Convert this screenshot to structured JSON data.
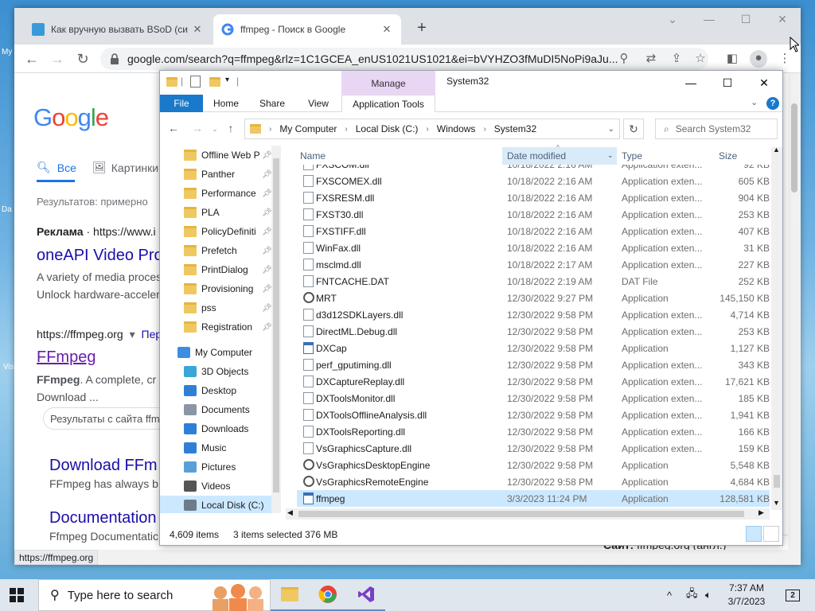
{
  "chrome": {
    "tabs": [
      {
        "title": "Как вручную вызвать BSoD (си",
        "close": "✕"
      },
      {
        "title": "ffmpeg - Поиск в Google",
        "close": "✕"
      }
    ],
    "url": "google.com/search?q=ffmpeg&rlz=1C1GCEA_enUS1021US1021&ei=bVYHZO3fMuDI5NoPi9aJu...",
    "status_url": "https://ffmpeg.org"
  },
  "google": {
    "tab_all": "Все",
    "tab_images": "Картинки",
    "results_count": "Результатов: примерно",
    "ad_label": "Реклама",
    "ad_url": "https://www.i",
    "ad_title": "oneAPI Video Pro",
    "ad_snippet_1": "A variety of media proces",
    "ad_snippet_2": "Unlock hardware-acceler",
    "result_url": "https://ffmpeg.org",
    "result_translate": "Пер",
    "result_title": "FFmpeg",
    "result_snippet_bold": "FFmpeg",
    "result_snippet_1": ". A complete, cr",
    "result_snippet_2": "Download ...",
    "sitelink_search": "Результаты с сайта ffm",
    "sub1_title": "Download FFm",
    "sub1_snippet": "FFmpeg has always b",
    "sub2_title": "Documentation",
    "sub2_snippet": "Ffmpeg Documentatic",
    "panel_label": "Сайт:",
    "panel_value": "ffmpeg.org (англ.)"
  },
  "explorer": {
    "manage": "Manage",
    "title": "System32",
    "ribbon_tabs": {
      "file": "File",
      "home": "Home",
      "share": "Share",
      "view": "View",
      "apptools": "Application Tools"
    },
    "path": [
      "My Computer",
      "Local Disk (C:)",
      "Windows",
      "System32"
    ],
    "search_placeholder": "Search System32",
    "columns": {
      "name": "Name",
      "date": "Date modified",
      "type": "Type",
      "size": "Size"
    },
    "nav_items": [
      {
        "label": "Offline Web P",
        "pinned": true
      },
      {
        "label": "Panther",
        "pinned": true
      },
      {
        "label": "Performance",
        "pinned": true
      },
      {
        "label": "PLA",
        "pinned": true
      },
      {
        "label": "PolicyDefiniti",
        "pinned": true
      },
      {
        "label": "Prefetch",
        "pinned": true
      },
      {
        "label": "PrintDialog",
        "pinned": true
      },
      {
        "label": "Provisioning",
        "pinned": true
      },
      {
        "label": "pss",
        "pinned": true
      },
      {
        "label": "Registration",
        "pinned": true
      }
    ],
    "nav_tree": [
      {
        "label": "My Computer",
        "icon": "computer-icon"
      },
      {
        "label": "3D Objects",
        "icon": "cube-icon"
      },
      {
        "label": "Desktop",
        "icon": "desktop-icon"
      },
      {
        "label": "Documents",
        "icon": "documents-icon"
      },
      {
        "label": "Downloads",
        "icon": "download-arrow-icon"
      },
      {
        "label": "Music",
        "icon": "music-note-icon"
      },
      {
        "label": "Pictures",
        "icon": "pictures-icon"
      },
      {
        "label": "Videos",
        "icon": "video-film-icon"
      },
      {
        "label": "Local Disk (C:)",
        "icon": "drive-icon"
      }
    ],
    "partial_row": {
      "name": "FXSCOM.dll",
      "date": "10/18/2022 2:16 AM",
      "type": "Application exten...",
      "size": "92 KB"
    },
    "files": [
      {
        "name": "FXSCOMEX.dll",
        "date": "10/18/2022 2:16 AM",
        "type": "Application exten...",
        "size": "605 KB",
        "icon": "dll"
      },
      {
        "name": "FXSRESM.dll",
        "date": "10/18/2022 2:16 AM",
        "type": "Application exten...",
        "size": "904 KB",
        "icon": "dll"
      },
      {
        "name": "FXST30.dll",
        "date": "10/18/2022 2:16 AM",
        "type": "Application exten...",
        "size": "253 KB",
        "icon": "dll"
      },
      {
        "name": "FXSTIFF.dll",
        "date": "10/18/2022 2:16 AM",
        "type": "Application exten...",
        "size": "407 KB",
        "icon": "dll"
      },
      {
        "name": "WinFax.dll",
        "date": "10/18/2022 2:16 AM",
        "type": "Application exten...",
        "size": "31 KB",
        "icon": "dll"
      },
      {
        "name": "msclmd.dll",
        "date": "10/18/2022 2:17 AM",
        "type": "Application exten...",
        "size": "227 KB",
        "icon": "dll"
      },
      {
        "name": "FNTCACHE.DAT",
        "date": "10/18/2022 2:19 AM",
        "type": "DAT File",
        "size": "252 KB",
        "icon": "dat"
      },
      {
        "name": "MRT",
        "date": "12/30/2022 9:27 PM",
        "type": "Application",
        "size": "145,150 KB",
        "icon": "gear"
      },
      {
        "name": "d3d12SDKLayers.dll",
        "date": "12/30/2022 9:58 PM",
        "type": "Application exten...",
        "size": "4,714 KB",
        "icon": "dll"
      },
      {
        "name": "DirectML.Debug.dll",
        "date": "12/30/2022 9:58 PM",
        "type": "Application exten...",
        "size": "253 KB",
        "icon": "dll"
      },
      {
        "name": "DXCap",
        "date": "12/30/2022 9:58 PM",
        "type": "Application",
        "size": "1,127 KB",
        "icon": "app"
      },
      {
        "name": "perf_gputiming.dll",
        "date": "12/30/2022 9:58 PM",
        "type": "Application exten...",
        "size": "343 KB",
        "icon": "dll"
      },
      {
        "name": "DXCaptureReplay.dll",
        "date": "12/30/2022 9:58 PM",
        "type": "Application exten...",
        "size": "17,621 KB",
        "icon": "dll"
      },
      {
        "name": "DXToolsMonitor.dll",
        "date": "12/30/2022 9:58 PM",
        "type": "Application exten...",
        "size": "185 KB",
        "icon": "dll"
      },
      {
        "name": "DXToolsOfflineAnalysis.dll",
        "date": "12/30/2022 9:58 PM",
        "type": "Application exten...",
        "size": "1,941 KB",
        "icon": "dll"
      },
      {
        "name": "DXToolsReporting.dll",
        "date": "12/30/2022 9:58 PM",
        "type": "Application exten...",
        "size": "166 KB",
        "icon": "dll"
      },
      {
        "name": "VsGraphicsCapture.dll",
        "date": "12/30/2022 9:58 PM",
        "type": "Application exten...",
        "size": "159 KB",
        "icon": "dll"
      },
      {
        "name": "VsGraphicsDesktopEngine",
        "date": "12/30/2022 9:58 PM",
        "type": "Application",
        "size": "5,548 KB",
        "icon": "gear"
      },
      {
        "name": "VsGraphicsRemoteEngine",
        "date": "12/30/2022 9:58 PM",
        "type": "Application",
        "size": "4,684 KB",
        "icon": "gear"
      },
      {
        "name": "ffmpeg",
        "date": "3/3/2023 11:24 PM",
        "type": "Application",
        "size": "128,581 KB",
        "icon": "app",
        "selected": true
      }
    ],
    "status_items": "4,609 items",
    "status_selected": "3 items selected",
    "status_size": "376 MB"
  },
  "taskbar": {
    "search_placeholder": "Type here to search",
    "time": "7:37 AM",
    "date": "3/7/2023",
    "notifications": "2"
  },
  "colors": {
    "google_blue": "#4285f4",
    "google_red": "#ea4335",
    "google_yellow": "#fbbc05",
    "google_green": "#34a853",
    "link_blue": "#1a0dab",
    "ribbon_file": "#1979ca",
    "manage_tab": "#e9d6f5",
    "selection": "#cce8ff"
  }
}
